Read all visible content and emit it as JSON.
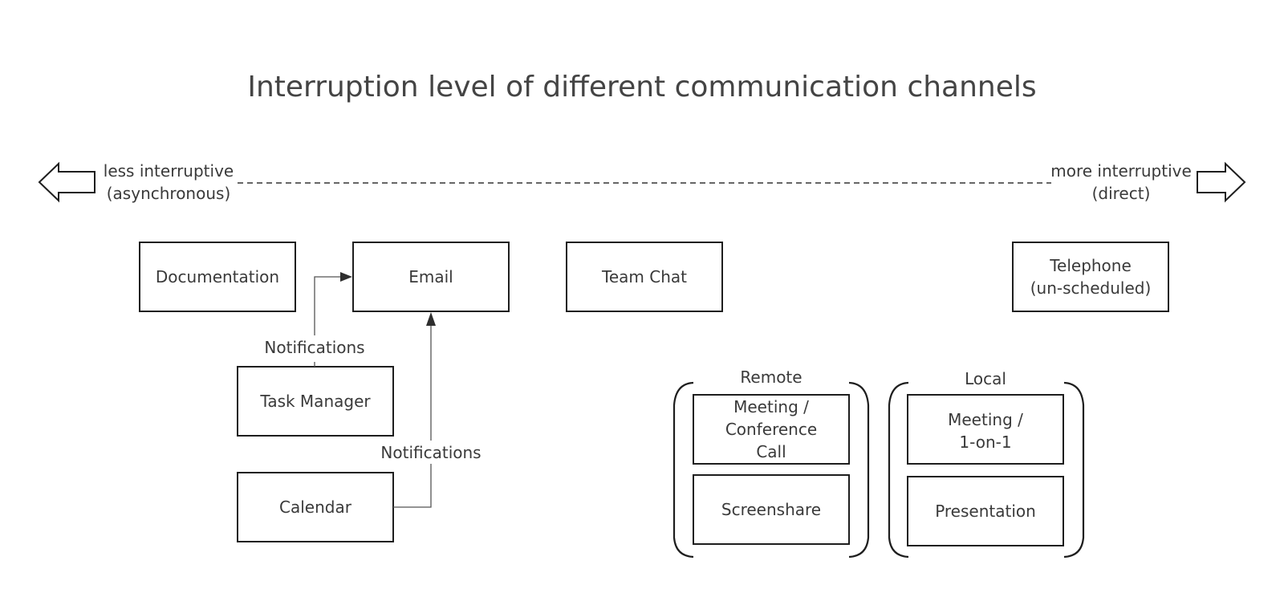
{
  "title": "Interruption level of different communication channels",
  "scale": {
    "left_label_line1": "less interruptive",
    "left_label_line2": "(asynchronous)",
    "right_label_line1": "more interruptive",
    "right_label_line2": "(direct)"
  },
  "nodes": {
    "documentation": "Documentation",
    "email": "Email",
    "team_chat": "Team Chat",
    "telephone_line1": "Telephone",
    "telephone_line2": "(un-scheduled)",
    "task_manager": "Task Manager",
    "calendar": "Calendar"
  },
  "connectors": {
    "task_manager_to_email": "Notifications",
    "calendar_to_email": "Notifications"
  },
  "groups": {
    "remote": {
      "label": "Remote",
      "meeting_line1": "Meeting /",
      "meeting_line2": "Conference",
      "meeting_line3": "Call",
      "screenshare": "Screenshare"
    },
    "local": {
      "label": "Local",
      "meeting_line1": "Meeting /",
      "meeting_line2": "1-on-1",
      "presentation": "Presentation"
    }
  }
}
